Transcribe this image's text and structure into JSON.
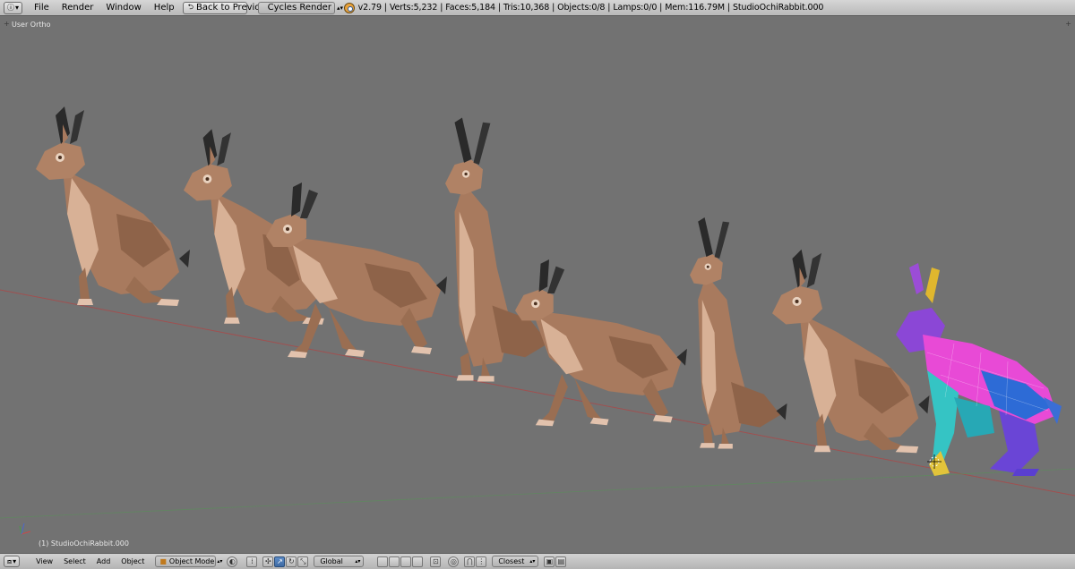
{
  "header": {
    "menu": [
      "File",
      "Render",
      "Window",
      "Help"
    ],
    "back_button": "Back to Previous",
    "render_engine": "Cycles Render",
    "stats": "v2.79 | Verts:5,232 | Faces:5,184 | Tris:10,368 | Objects:0/8 | Lamps:0/0 | Mem:116.79M | StudioOchiRabbit.000"
  },
  "viewport": {
    "view_label": "User Ortho",
    "active_object_label": "(1) StudioOchiRabbit.000"
  },
  "footer": {
    "menu": [
      "View",
      "Select",
      "Add",
      "Object"
    ],
    "mode": "Object Mode",
    "orientation": "Global",
    "snap_target": "Closest"
  },
  "colors": {
    "viewport_bg": "#727272",
    "rabbit_fur": "#a87a5e",
    "rabbit_light": "#d8b196",
    "ear_tip": "#2a2a2a",
    "x_axis": "#a05050",
    "y_axis": "#5a8f5a"
  }
}
